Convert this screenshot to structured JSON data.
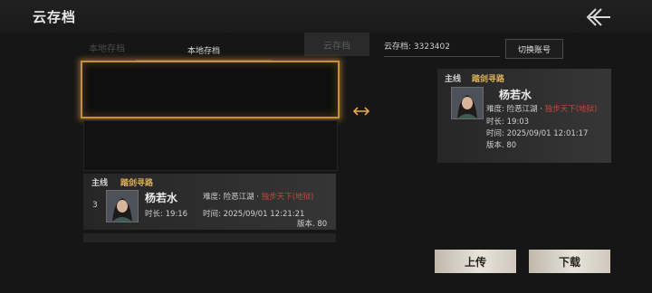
{
  "header": {
    "title": "云存档"
  },
  "tabs": {
    "ghost_label": "本地存档",
    "local_label": "本地存档",
    "cloud_label": "云存档"
  },
  "cloud": {
    "id_label": "云存档: 3323402",
    "switch_label": "切换账号"
  },
  "local_save": {
    "mainline": "主线",
    "chapter": "踏剑寻路",
    "index": "3",
    "name": "杨若水",
    "difficulty_label": "难度: 险恶江湖 ·",
    "difficulty_mode": "独步天下(地狱)",
    "duration": "时长: 19:16",
    "time": "时间: 2025/09/01 12:21:21",
    "version": "版本. 80"
  },
  "cloud_save": {
    "mainline": "主线",
    "chapter": "踏剑寻路",
    "name": "杨若水",
    "difficulty_label": "难度: 险恶江湖 ·",
    "difficulty_mode": "独步天下(地狱)",
    "duration": "时长: 19:03",
    "time": "时间: 2025/09/01 12:01:17",
    "version": "版本. 80"
  },
  "buttons": {
    "upload": "上传",
    "download": "下载"
  },
  "icons": {
    "back": "back-arrow-icon",
    "swap": "swap-arrows-icon",
    "portrait": "character-portrait-icon"
  },
  "colors": {
    "accent_gold": "#c4903c",
    "chapter_gold": "#e0b15a",
    "hell_red": "#c9473c"
  }
}
